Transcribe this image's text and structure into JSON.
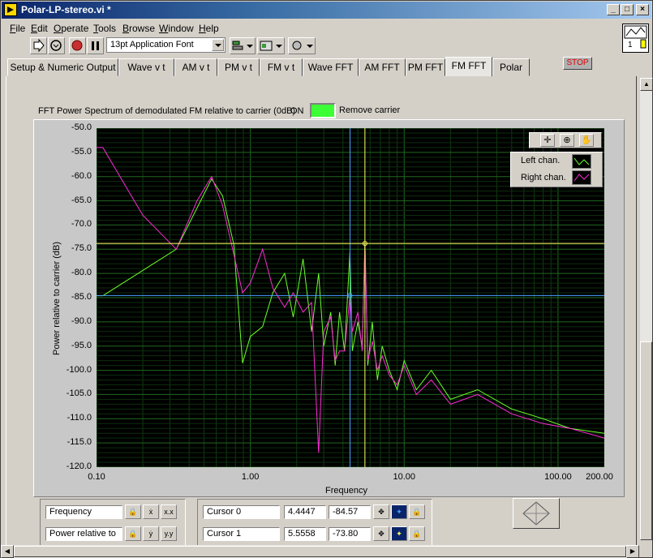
{
  "window": {
    "title": "Polar-LP-stereo.vi *"
  },
  "menu": [
    "File",
    "Edit",
    "Operate",
    "Tools",
    "Browse",
    "Window",
    "Help"
  ],
  "toolbar": {
    "font": "13pt Application Font"
  },
  "connector_pane": {
    "text": "1"
  },
  "tabs": [
    "Setup & Numeric Output",
    "Wave v t",
    "AM v t",
    "PM v t",
    "FM  v t",
    "Wave FFT",
    "AM FFT",
    "PM FFT",
    "FM FFT",
    "Polar"
  ],
  "active_tab": 8,
  "stop_label": "STOP",
  "graph": {
    "label": "FFT Power Spectrum of demodulated FM relative to carrier (0dB)",
    "switch_state": "ON",
    "switch_label": "Remove carrier",
    "led_color": "#3dff35"
  },
  "legend": {
    "items": [
      {
        "name": "Left chan.",
        "color": "#6cff2a"
      },
      {
        "name": "Right chan.",
        "color": "#ff2ad8"
      }
    ]
  },
  "scale_legend": {
    "x_name": "Frequency",
    "y_name": "Power relative to"
  },
  "cursors": [
    {
      "name": "Cursor 0",
      "x": "4.4447",
      "y": "-84.57",
      "color": "#4aa0ff"
    },
    {
      "name": "Cursor 1",
      "x": "5.5558",
      "y": "-73.80",
      "color": "#ffff60"
    }
  ],
  "chart_data": {
    "type": "line",
    "xlabel": "Frequency",
    "ylabel": "Power relative to carrier (dB)",
    "x_scale": "log",
    "xlim": [
      0.1,
      200
    ],
    "ylim": [
      -120,
      -50
    ],
    "grid": true,
    "x_ticks": [
      "0.10",
      "1.00",
      "10.00",
      "100.00",
      "200.00"
    ],
    "y_ticks": [
      "-50.0",
      "-55.0",
      "-60.0",
      "-65.0",
      "-70.0",
      "-75.0",
      "-80.0",
      "-85.0",
      "-90.0",
      "-95.0",
      "-100.0",
      "-105.0",
      "-110.0",
      "-115.0",
      "-120.0"
    ],
    "legend_position": "top-right",
    "series": [
      {
        "name": "Left chan.",
        "color": "#6cff2a",
        "x": [
          0.1,
          0.11,
          0.33,
          0.56,
          0.66,
          0.78,
          0.89,
          1.0,
          1.2,
          1.4,
          1.67,
          1.9,
          2.2,
          2.5,
          2.78,
          3.0,
          3.33,
          3.56,
          3.8,
          4.1,
          4.44,
          4.6,
          5.0,
          5.33,
          5.56,
          5.8,
          6.2,
          6.7,
          7.2,
          8.0,
          9.0,
          10.0,
          12.0,
          15.0,
          20.0,
          30.0,
          50.0,
          80.0,
          120.0,
          200.0
        ],
        "y": [
          -84.6,
          -84.6,
          -75,
          -60.5,
          -64,
          -74,
          -98.5,
          -93,
          -91,
          -84,
          -80,
          -89,
          -77,
          -92,
          -80,
          -95,
          -88,
          -99,
          -88,
          -96,
          -75.5,
          -96,
          -90,
          -95,
          -73.8,
          -99,
          -90,
          -102,
          -95,
          -100,
          -104,
          -98,
          -104,
          -100,
          -106,
          -104,
          -108,
          -110,
          -112,
          -113
        ]
      },
      {
        "name": "Right chan.",
        "color": "#ff2ad8",
        "x": [
          0.1,
          0.11,
          0.2,
          0.33,
          0.45,
          0.56,
          0.66,
          0.78,
          0.89,
          1.0,
          1.2,
          1.4,
          1.67,
          1.9,
          2.2,
          2.5,
          2.78,
          3.0,
          3.33,
          3.56,
          3.8,
          4.1,
          4.44,
          4.6,
          5.0,
          5.33,
          5.56,
          5.8,
          6.2,
          6.7,
          7.2,
          8.0,
          9.0,
          10.0,
          12.0,
          15.0,
          20.0,
          30.0,
          50.0,
          80.0,
          120.0,
          200.0
        ],
        "y": [
          -54,
          -54,
          -68,
          -75,
          -65,
          -60,
          -66,
          -76,
          -84,
          -82,
          -75,
          -83,
          -87,
          -84,
          -88,
          -86,
          -117,
          -92,
          -89,
          -98,
          -96,
          -96,
          -84.6,
          -92,
          -88,
          -96,
          -74,
          -98,
          -94,
          -100,
          -97,
          -101,
          -103,
          -99,
          -105,
          -102,
          -107,
          -105,
          -109,
          -111,
          -112,
          -114
        ]
      }
    ]
  }
}
